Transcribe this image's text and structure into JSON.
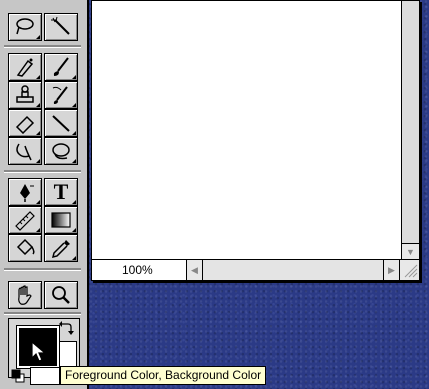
{
  "document": {
    "zoom_level": "100%"
  },
  "tooltip": {
    "text": "Foreground Color, Background Color"
  },
  "toolbox": {
    "tools": [
      {
        "row": 0,
        "col": 0,
        "icon": "lasso-icon"
      },
      {
        "row": 0,
        "col": 1,
        "icon": "magic-wand-icon"
      },
      {
        "row": 1,
        "col": 0,
        "icon": "airbrush-icon"
      },
      {
        "row": 1,
        "col": 1,
        "icon": "paintbrush-icon"
      },
      {
        "row": 2,
        "col": 0,
        "icon": "rubber-stamp-icon"
      },
      {
        "row": 2,
        "col": 1,
        "icon": "history-brush-icon"
      },
      {
        "row": 3,
        "col": 0,
        "icon": "eraser-icon"
      },
      {
        "row": 3,
        "col": 1,
        "icon": "line-icon"
      },
      {
        "row": 4,
        "col": 0,
        "icon": "blur-icon"
      },
      {
        "row": 4,
        "col": 1,
        "icon": "burn-icon"
      },
      {
        "row": 5,
        "col": 0,
        "icon": "pen-icon"
      },
      {
        "row": 5,
        "col": 1,
        "icon": "type-icon",
        "glyph": "T"
      },
      {
        "row": 6,
        "col": 0,
        "icon": "measure-icon"
      },
      {
        "row": 6,
        "col": 1,
        "icon": "gradient-icon"
      },
      {
        "row": 7,
        "col": 0,
        "icon": "paint-bucket-icon"
      },
      {
        "row": 7,
        "col": 1,
        "icon": "eyedropper-icon"
      },
      {
        "row": 8,
        "col": 0,
        "icon": "hand-icon"
      },
      {
        "row": 8,
        "col": 1,
        "icon": "zoom-icon"
      }
    ]
  },
  "colors": {
    "foreground": "#000000",
    "background": "#ffffff",
    "desktop": "#2b3a86"
  }
}
